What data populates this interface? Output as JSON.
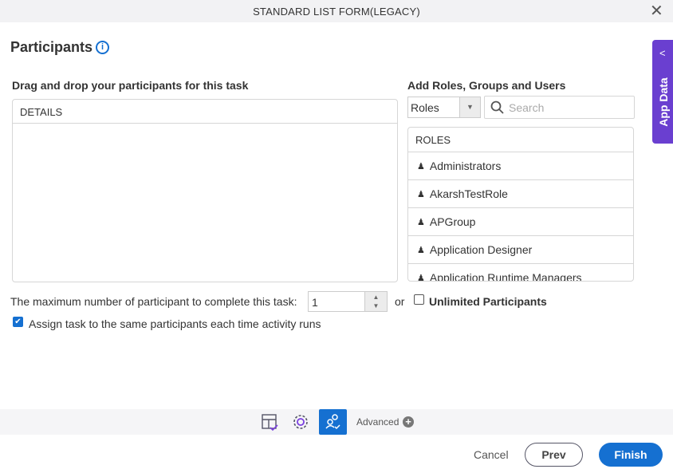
{
  "window": {
    "title": "STANDARD LIST FORM(LEGACY)",
    "close_icon": "close-icon"
  },
  "page": {
    "heading": "Participants",
    "info_icon": "i"
  },
  "details_panel": {
    "label": "Drag and drop your participants for this task",
    "header": "DETAILS"
  },
  "add_panel": {
    "label": "Add Roles, Groups and Users",
    "type_select": {
      "value": "Roles"
    },
    "search": {
      "placeholder": "Search",
      "value": ""
    },
    "list_header": "ROLES",
    "items": [
      "Administrators",
      "AkarshTestRole",
      "APGroup",
      "Application Designer",
      "Application Runtime Managers"
    ]
  },
  "options": {
    "max_label": "The maximum number of participant to complete this task:",
    "max_value": "1",
    "or_label": "or",
    "unlimited_label": "Unlimited Participants",
    "unlimited_checked": false,
    "assign_label": "Assign task to the same participants each time activity runs",
    "assign_checked": true
  },
  "toolbar": {
    "advanced_label": "Advanced"
  },
  "footer": {
    "cancel": "Cancel",
    "prev": "Prev",
    "finish": "Finish"
  },
  "side_tab": {
    "label": "App Data"
  },
  "colors": {
    "accent": "#1570d1",
    "side_tab": "#6a3fd0"
  }
}
